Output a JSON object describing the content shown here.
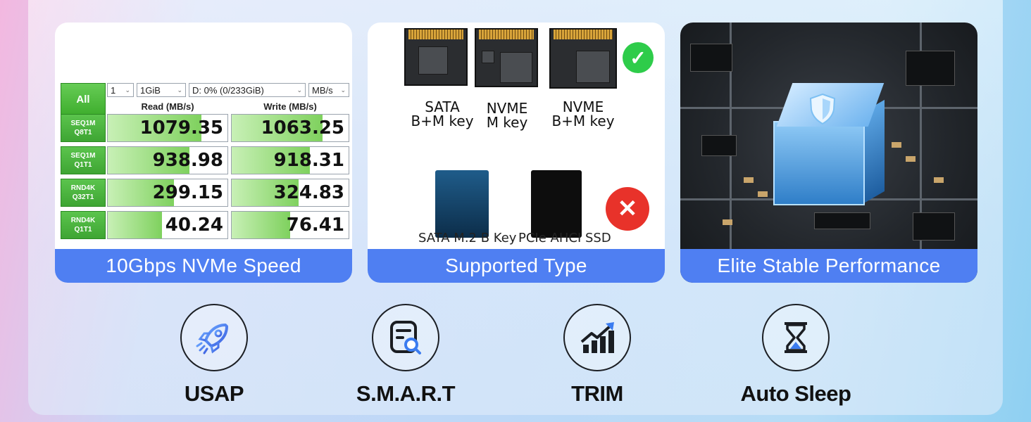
{
  "cards": {
    "speed": {
      "label": "10Gbps NVMe Speed",
      "benchmark": {
        "all_button": "All",
        "selectors": [
          "1",
          "1GiB",
          "D: 0% (0/233GiB)",
          "MB/s"
        ],
        "read_header": "Read (MB/s)",
        "write_header": "Write (MB/s)",
        "rows": [
          {
            "label1": "SEQ1M",
            "label2": "Q8T1",
            "read": "1079.35",
            "write": "1063.25",
            "read_fill": 0.78,
            "write_fill": 0.78
          },
          {
            "label1": "SEQ1M",
            "label2": "Q1T1",
            "read": "938.98",
            "write": "918.31",
            "read_fill": 0.68,
            "write_fill": 0.67
          },
          {
            "label1": "RND4K",
            "label2": "Q32T1",
            "read": "299.15",
            "write": "324.83",
            "read_fill": 0.55,
            "write_fill": 0.57
          },
          {
            "label1": "RND4K",
            "label2": "Q1T1",
            "read": "40.24",
            "write": "76.41",
            "read_fill": 0.45,
            "write_fill": 0.5
          }
        ]
      }
    },
    "types": {
      "label": "Supported Type",
      "supported": [
        {
          "line1": "SATA",
          "line2": "B+M key"
        },
        {
          "line1": "NVME",
          "line2": "M key"
        },
        {
          "line1": "NVME",
          "line2": "B+M key"
        }
      ],
      "unsupported": [
        "SATA M.2 B Key",
        "PCIe AHCI SSD"
      ],
      "check_color": "#2ecc4a",
      "cross_color": "#e8322a"
    },
    "performance": {
      "label": "Elite Stable Performance"
    }
  },
  "features": [
    {
      "label": "USAP",
      "icon": "rocket-icon"
    },
    {
      "label": "S.M.A.R.T",
      "icon": "document-search-icon"
    },
    {
      "label": "TRIM",
      "icon": "bar-chart-arrow-icon"
    },
    {
      "label": "Auto Sleep",
      "icon": "hourglass-icon"
    }
  ],
  "colors": {
    "accent_blue": "#4f7ff2"
  }
}
